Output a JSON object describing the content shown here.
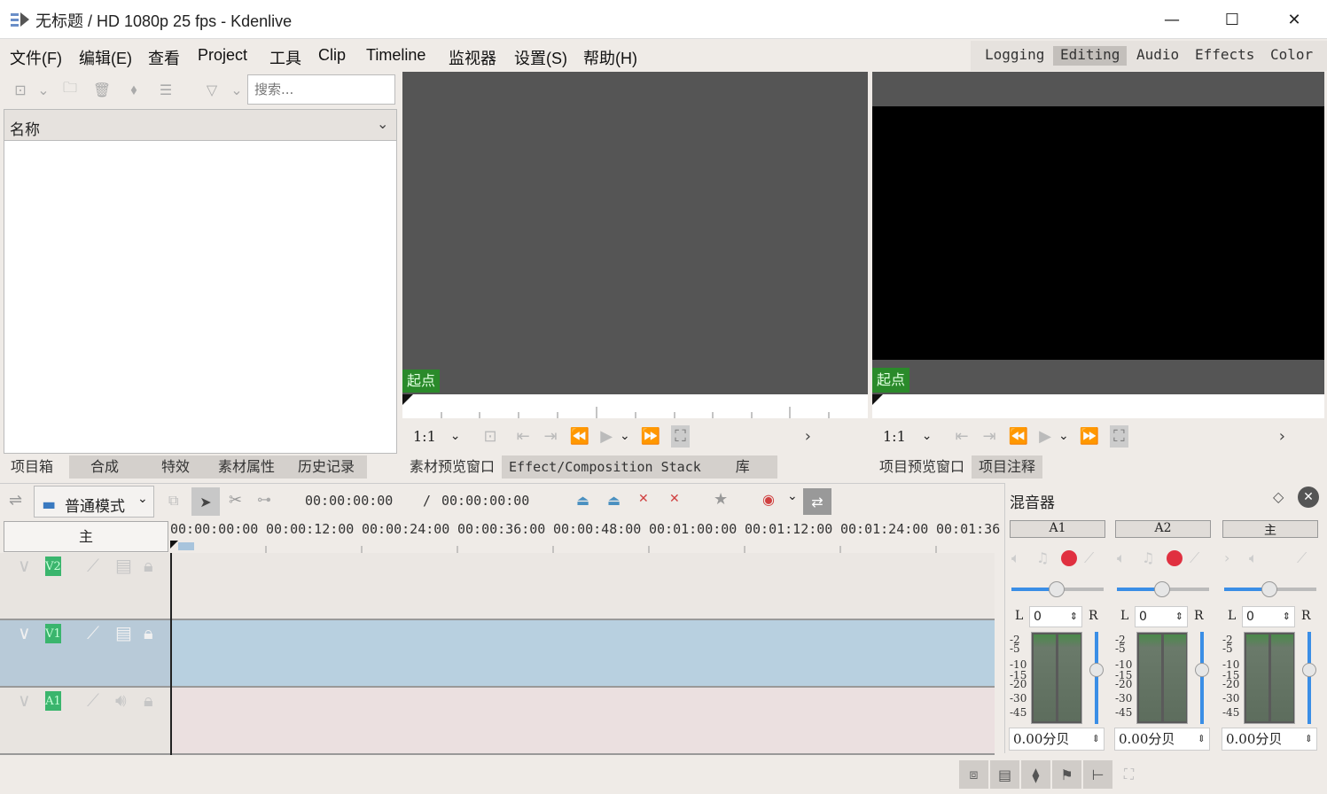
{
  "window": {
    "title": "无标题 / HD 1080p 25 fps - Kdenlive",
    "minimize": "—",
    "maximize": "☐",
    "close": "✕"
  },
  "menu": [
    "文件(F)",
    "编辑(E)",
    "查看",
    "Project",
    "工具",
    "Clip",
    "Timeline",
    "监视器",
    "设置(S)",
    "帮助(H)"
  ],
  "workspaces": [
    "Logging",
    "Editing",
    "Audio",
    "Effects",
    "Color"
  ],
  "bin": {
    "search_placeholder": "搜索...",
    "column": "名称"
  },
  "left_tabs": [
    "项目箱",
    "合成",
    "特效",
    "素材属性",
    "历史记录"
  ],
  "clip_monitor": {
    "marker": "起点",
    "zoom": "1:1"
  },
  "project_monitor": {
    "marker": "起点",
    "zoom": "1:1"
  },
  "mid_tabs": [
    "素材预览窗口",
    "Effect/Composition Stack",
    "库"
  ],
  "right_tabs": [
    "项目预览窗口",
    "项目注释"
  ],
  "timeline": {
    "mode": "普通模式",
    "timecode": "00:00:00:00",
    "duration": "00:00:00:00",
    "separator": "/",
    "master": "主",
    "ruler": [
      "00:00:00:00",
      "00:00:12:00",
      "00:00:24:00",
      "00:00:36:00",
      "00:00:48:00",
      "00:01:00:00",
      "00:01:12:00",
      "00:01:24:00",
      "00:01:36"
    ],
    "tracks": [
      {
        "name": "V2"
      },
      {
        "name": "V1"
      },
      {
        "name": "A1"
      }
    ]
  },
  "mixer": {
    "title": "混音器",
    "channels": [
      {
        "name": "A1",
        "balance": "0",
        "level": "0.00分贝"
      },
      {
        "name": "A2",
        "balance": "0",
        "level": "0.00分贝"
      },
      {
        "name": "主",
        "balance": "0",
        "level": "0.00分贝"
      }
    ],
    "scale": [
      "-2",
      "-5",
      "-10",
      "-15",
      "-20",
      "-30",
      "-45"
    ],
    "left": "L",
    "right": "R"
  },
  "colors": {
    "accent": "#3ab56d",
    "selected_track": "#b8d0e0",
    "audio_track": "#ebe0e0"
  }
}
